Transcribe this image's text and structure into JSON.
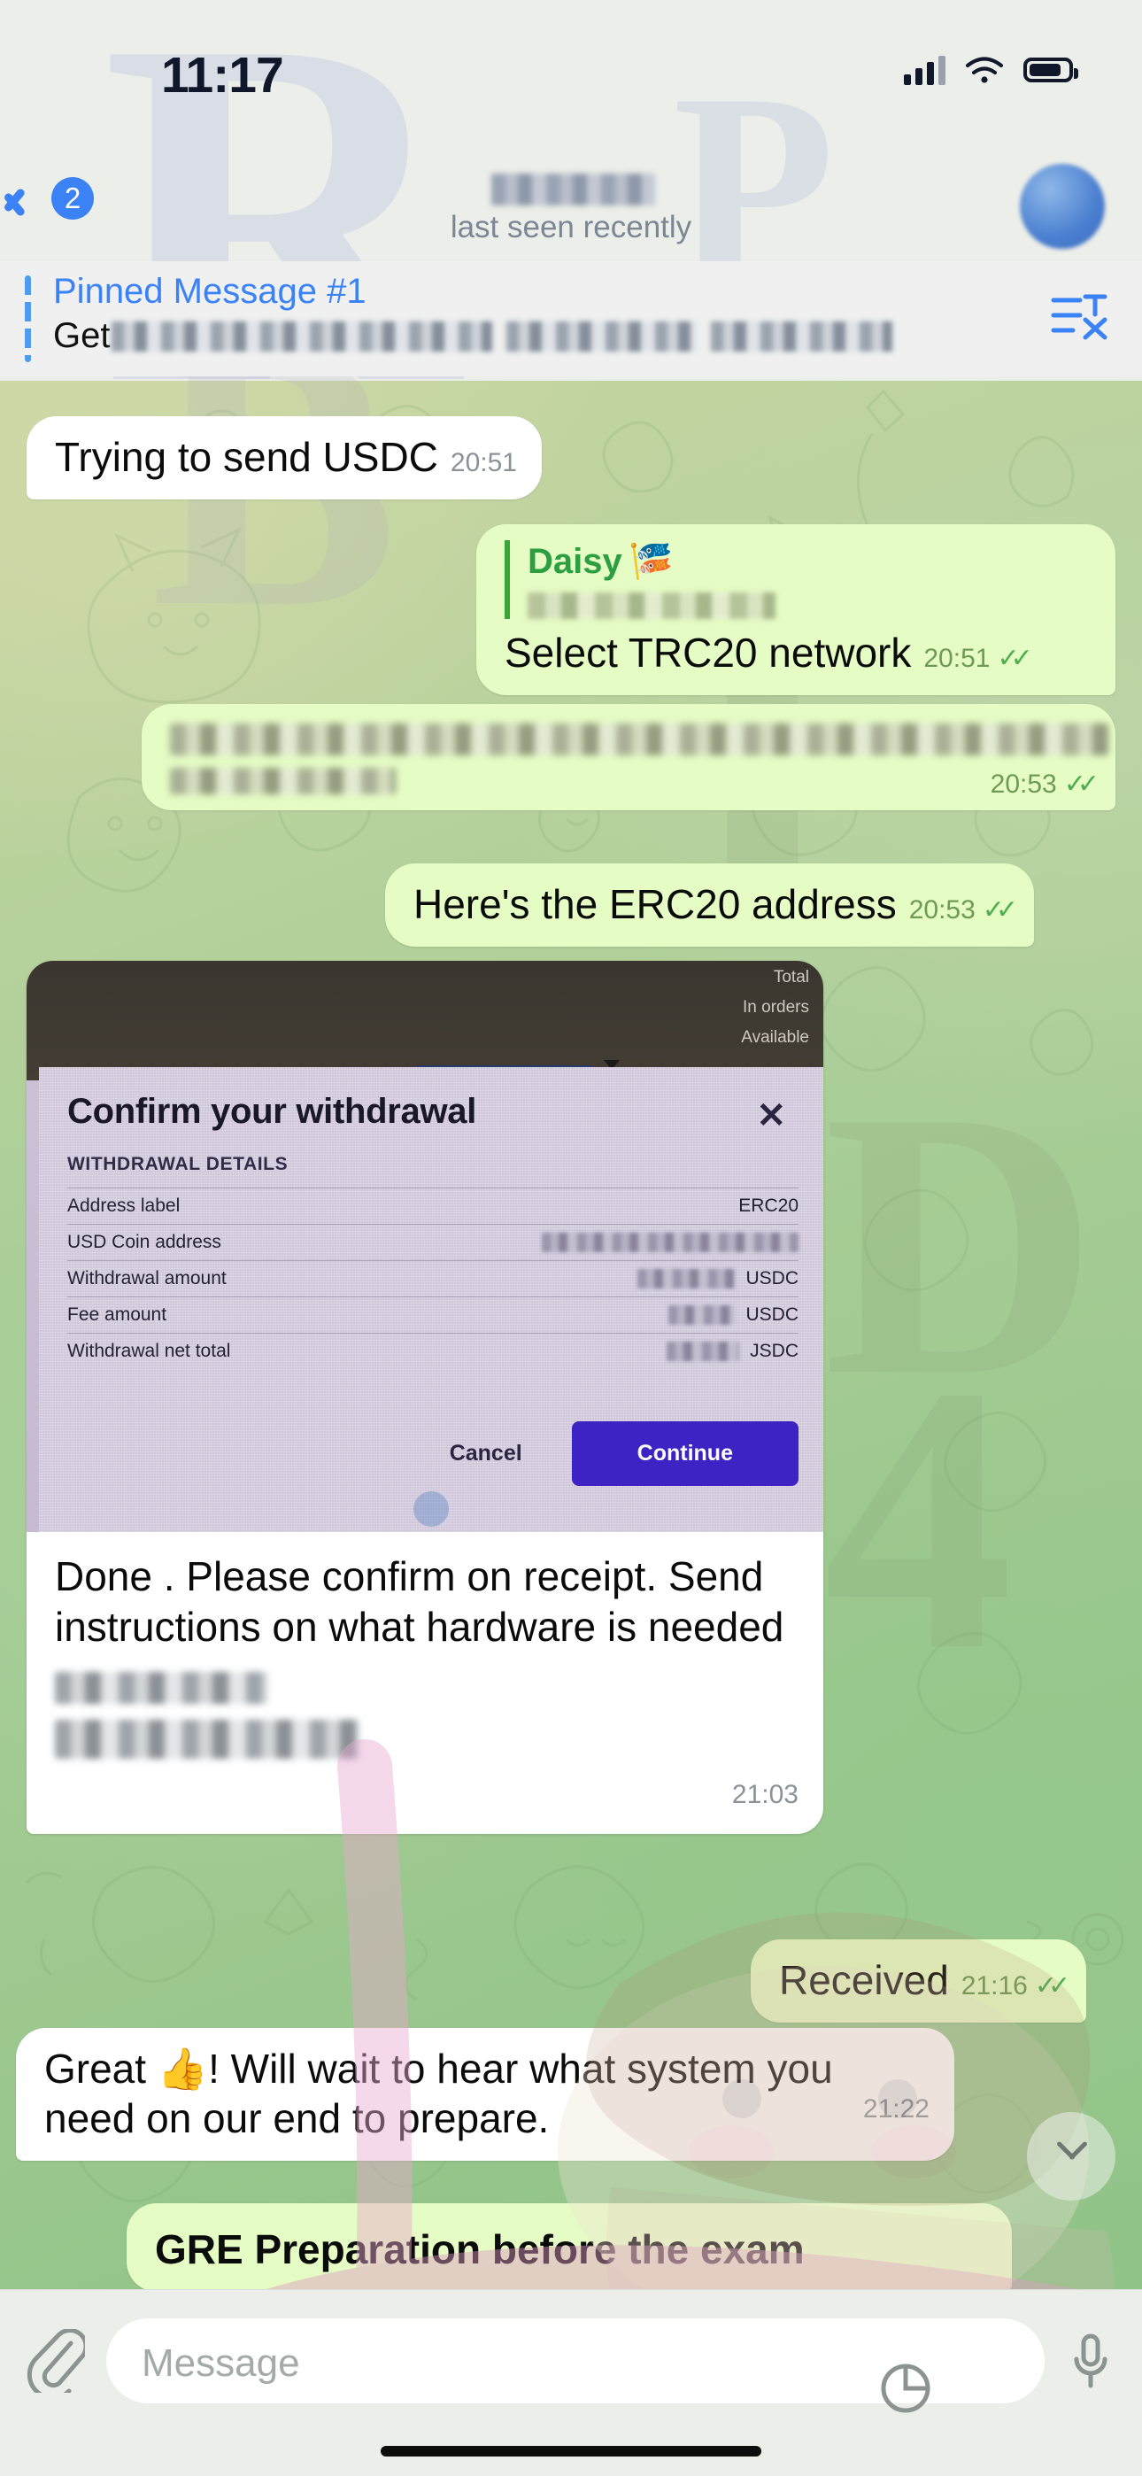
{
  "status_bar": {
    "time": "11:17",
    "signal_icon": "signal-bars-icon",
    "wifi_icon": "wifi-icon",
    "battery_icon": "battery-icon"
  },
  "header": {
    "back_icon": "chevron-left-icon",
    "unread_count": "2",
    "title": "",
    "subtitle": "last seen recently",
    "avatar_icon": "contact-avatar"
  },
  "pinned": {
    "label": "Pinned Message #1",
    "preview_prefix": "Get",
    "list_icon": "pinned-messages-list-icon"
  },
  "messages": [
    {
      "id": "m1",
      "direction": "in",
      "text": "Trying to send USDC",
      "time": "20:51"
    },
    {
      "id": "m2",
      "direction": "out",
      "reply_name": "Daisy",
      "reply_emoji": "🎏",
      "text": "Select TRC20 network",
      "time": "20:51",
      "ticks": "✓✓"
    },
    {
      "id": "m3",
      "direction": "out",
      "text": "",
      "time": "20:53",
      "ticks": "✓✓"
    },
    {
      "id": "m4",
      "direction": "out",
      "text": "Here's the ERC20 address",
      "time": "20:53",
      "ticks": "✓✓"
    },
    {
      "id": "m5",
      "direction": "in",
      "type": "photo",
      "caption": "Done . Please confirm on receipt. Send instructions on what hardware is needed",
      "time": "21:03"
    },
    {
      "id": "m6",
      "direction": "out",
      "text": "Received",
      "time": "21:16",
      "ticks": "✓✓"
    },
    {
      "id": "m7",
      "direction": "in",
      "text": "Great 👍! Will wait to hear what system you need on our end to prepare.",
      "time": "21:22"
    },
    {
      "id": "m8",
      "direction": "out",
      "text": "GRE Preparation before the exam",
      "time": ""
    }
  ],
  "photo": {
    "top_labels": [
      "Total",
      "In orders",
      "Available"
    ],
    "dialog_title": "Confirm your withdrawal",
    "close_icon": "close-x-icon",
    "section_title": "WITHDRAWAL DETAILS",
    "rows": [
      {
        "key": "Address label",
        "value": "ERC20",
        "redacted": false
      },
      {
        "key": "USD Coin address",
        "value": "",
        "redacted": true
      },
      {
        "key": "Withdrawal amount",
        "value": "USDC",
        "redacted": true
      },
      {
        "key": "Fee amount",
        "value": "USDC",
        "redacted": true
      },
      {
        "key": "Withdrawal net total",
        "value": "JSDC",
        "redacted": true
      }
    ],
    "cancel_label": "Cancel",
    "continue_label": "Continue"
  },
  "scroll_down": {
    "icon": "chevron-down-icon"
  },
  "input_bar": {
    "attach_icon": "paperclip-icon",
    "placeholder": "Message",
    "sticker_icon": "sticker-icon",
    "mic_icon": "microphone-icon"
  },
  "watermark": {
    "letters": [
      "R",
      "P",
      "B",
      "I",
      "D",
      "4"
    ]
  },
  "colors": {
    "accent_blue": "#3b82f6",
    "out_bubble": "#e5fcc4",
    "in_bubble": "#ffffff",
    "tick_green": "#4fae4f",
    "reply_green": "#2e9e43",
    "continue_button": "#3d22c4",
    "chat_green": "#a8cd96"
  }
}
